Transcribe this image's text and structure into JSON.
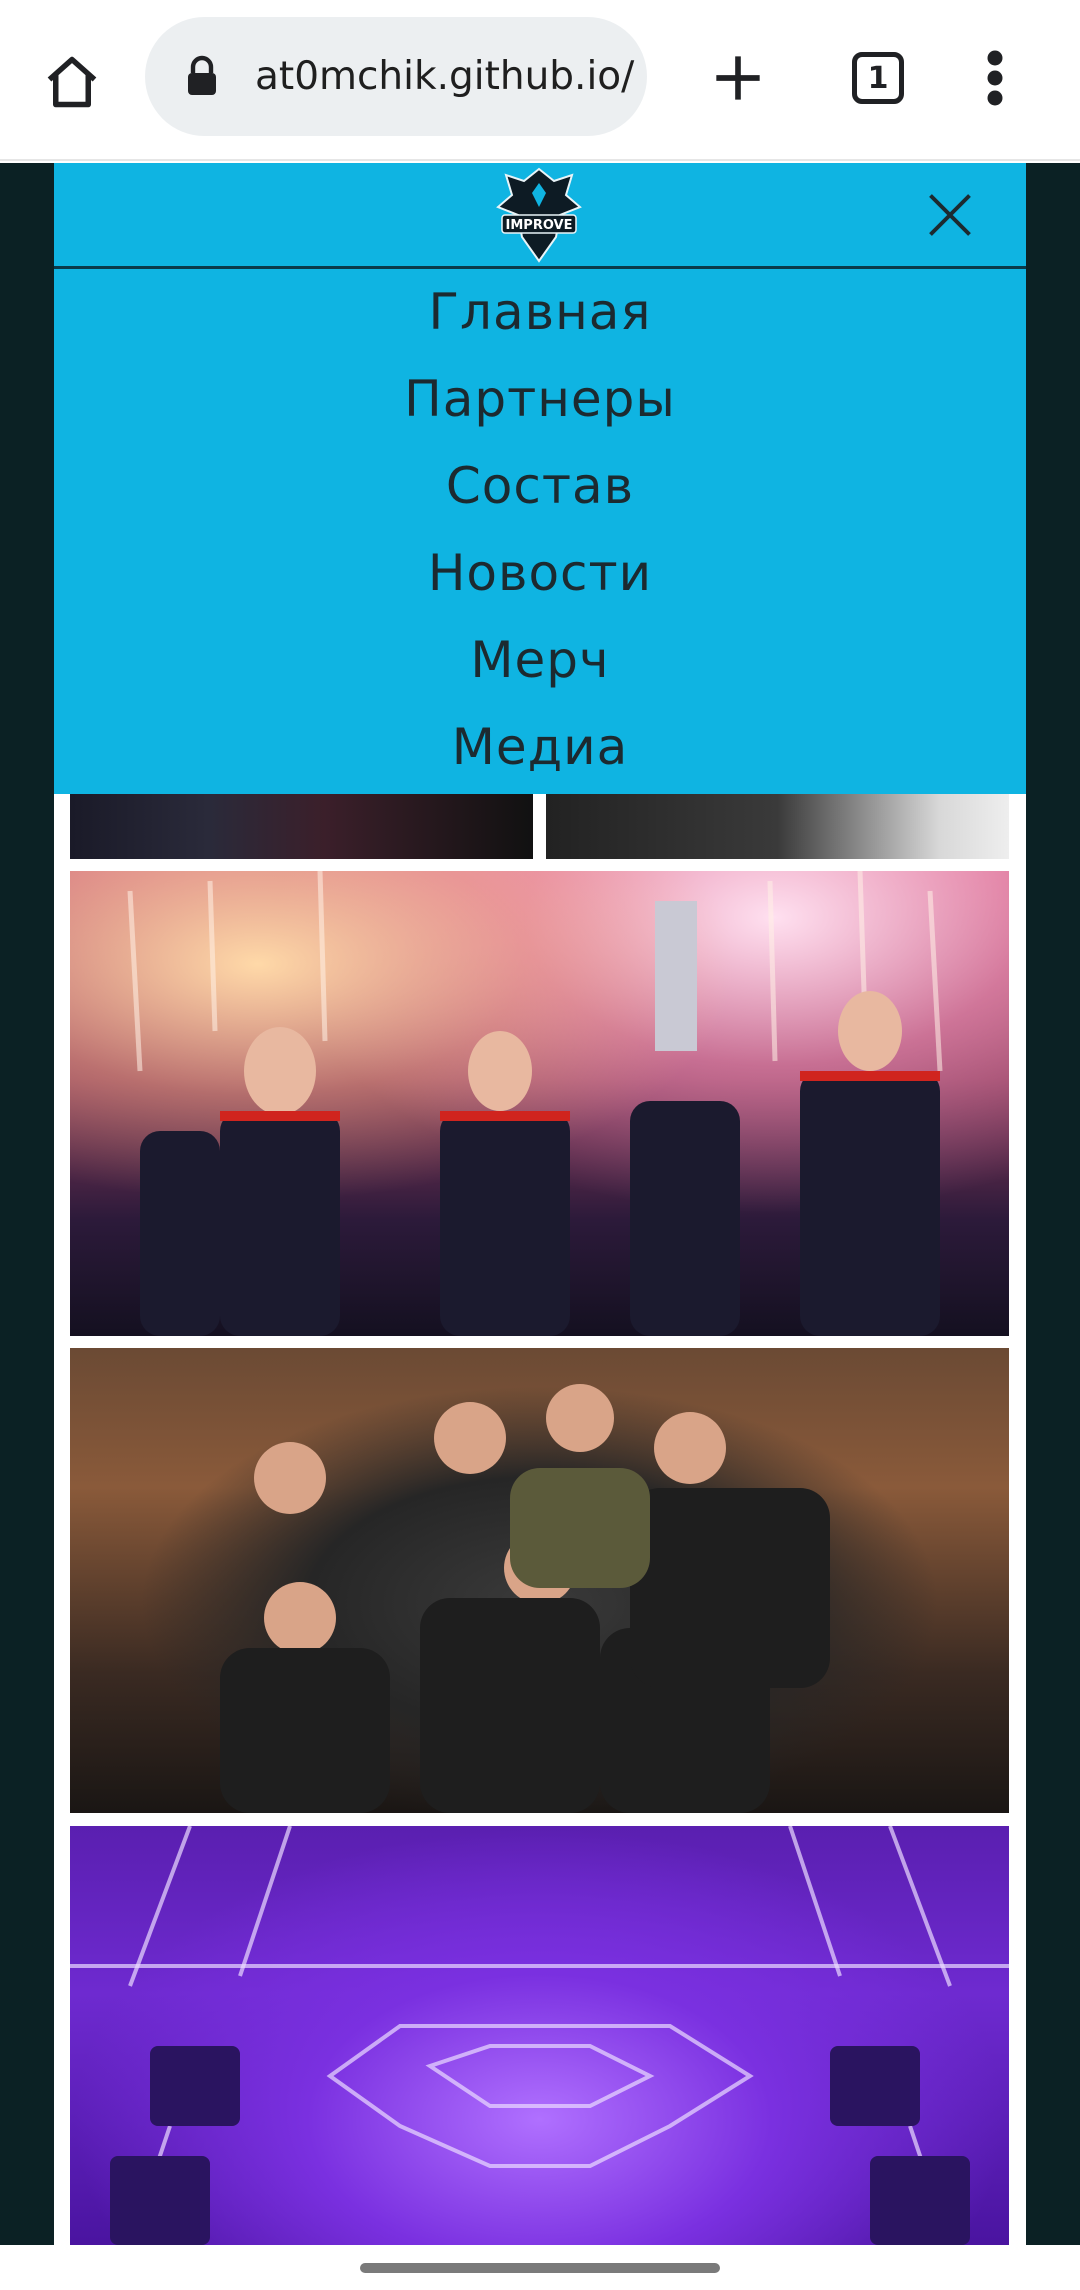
{
  "browser": {
    "url": "at0mchik.github.io/",
    "tab_count": "1",
    "icons": {
      "home": "home-icon",
      "lock": "lock-icon",
      "new_tab": "plus-icon",
      "tabs": "tabs-icon",
      "menu": "more-vert-icon"
    }
  },
  "nav": {
    "logo_text": "IMPROVE",
    "items": [
      {
        "label": "Главная"
      },
      {
        "label": "Партнеры"
      },
      {
        "label": "Состав"
      },
      {
        "label": "Новости"
      },
      {
        "label": "Мерч"
      },
      {
        "label": "Медиа"
      }
    ],
    "close_icon": "close-icon",
    "background_color": "#0fb4e2",
    "text_color": "#1c2a30"
  },
  "gallery": {
    "photos": [
      {
        "name": "team-photo-left-partial"
      },
      {
        "name": "team-photo-right-partial"
      },
      {
        "name": "trophy-celebration-photo"
      },
      {
        "name": "team-group-photo"
      },
      {
        "name": "arena-stage-photo"
      }
    ]
  },
  "colors": {
    "page_background": "#0b2124",
    "accent": "#0fb4e2"
  }
}
